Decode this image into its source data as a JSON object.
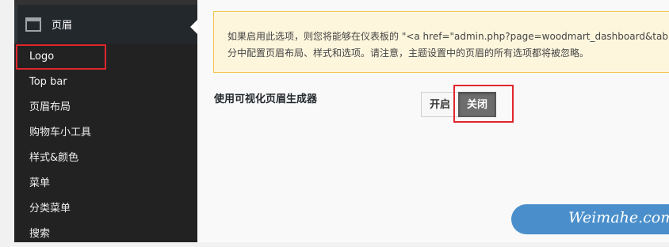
{
  "sidebar": {
    "header_label": "页眉",
    "header_icon": "window-icon",
    "items": [
      {
        "label": "Logo",
        "active": true
      },
      {
        "label": "Top bar"
      },
      {
        "label": "页眉布局"
      },
      {
        "label": "购物车小工具"
      },
      {
        "label": "样式&颜色"
      },
      {
        "label": "菜单"
      },
      {
        "label": "分类菜单"
      },
      {
        "label": "搜索"
      }
    ]
  },
  "notice": {
    "line1": "如果启用此选项，则您将能够在仪表板的 \"<a href=\"admin.php?page=woodmart_dashboard&tab=",
    "line2": "分中配置页眉布局、样式和选项。请注意，主题设置中的页眉的所有选项都将被忽略。"
  },
  "setting": {
    "label": "使用可视化页眉生成器",
    "on_label": "开启",
    "off_label": "关闭",
    "selected": "off"
  },
  "watermark": {
    "text": "Weimahe.com"
  },
  "colors": {
    "sidebar_bg": "#222222",
    "highlight": "#e0262b",
    "notice_border": "#f1c453",
    "watermark_bg": "#4a8fcb"
  }
}
